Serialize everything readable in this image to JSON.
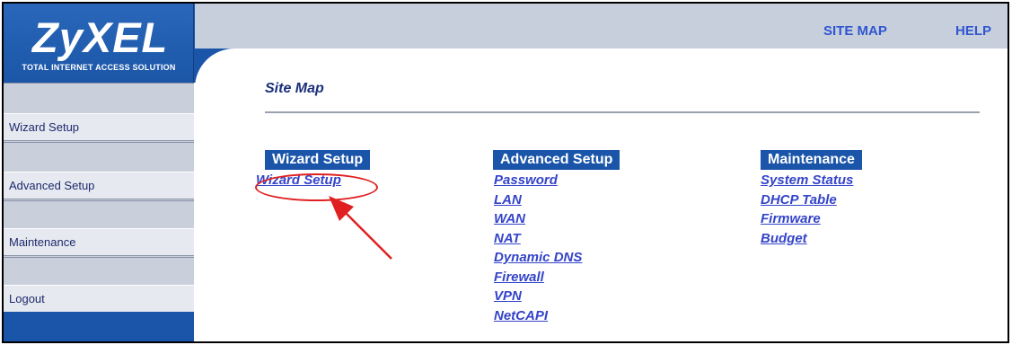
{
  "brand": {
    "logo": "ZyXEL",
    "tagline": "TOTAL INTERNET ACCESS SOLUTION"
  },
  "top_links": {
    "site_map": "SITE MAP",
    "help": "HELP"
  },
  "sidebar": {
    "items": [
      {
        "label": "Wizard Setup"
      },
      {
        "label": "Advanced Setup"
      },
      {
        "label": "Maintenance"
      },
      {
        "label": "Logout"
      }
    ]
  },
  "main": {
    "title": "Site Map",
    "columns": [
      {
        "header": "Wizard Setup",
        "links": [
          "Wizard Setup"
        ]
      },
      {
        "header": "Advanced Setup",
        "links": [
          "Password",
          "LAN",
          "WAN",
          "NAT",
          "Dynamic DNS",
          "Firewall",
          "VPN",
          "NetCAPI"
        ]
      },
      {
        "header": "Maintenance",
        "links": [
          "System Status",
          "DHCP Table",
          "Firmware",
          "Budget"
        ]
      }
    ]
  },
  "colors": {
    "brand_blue": "#1a55a9",
    "link_blue": "#3444c8",
    "highlight_red": "#e02020"
  }
}
